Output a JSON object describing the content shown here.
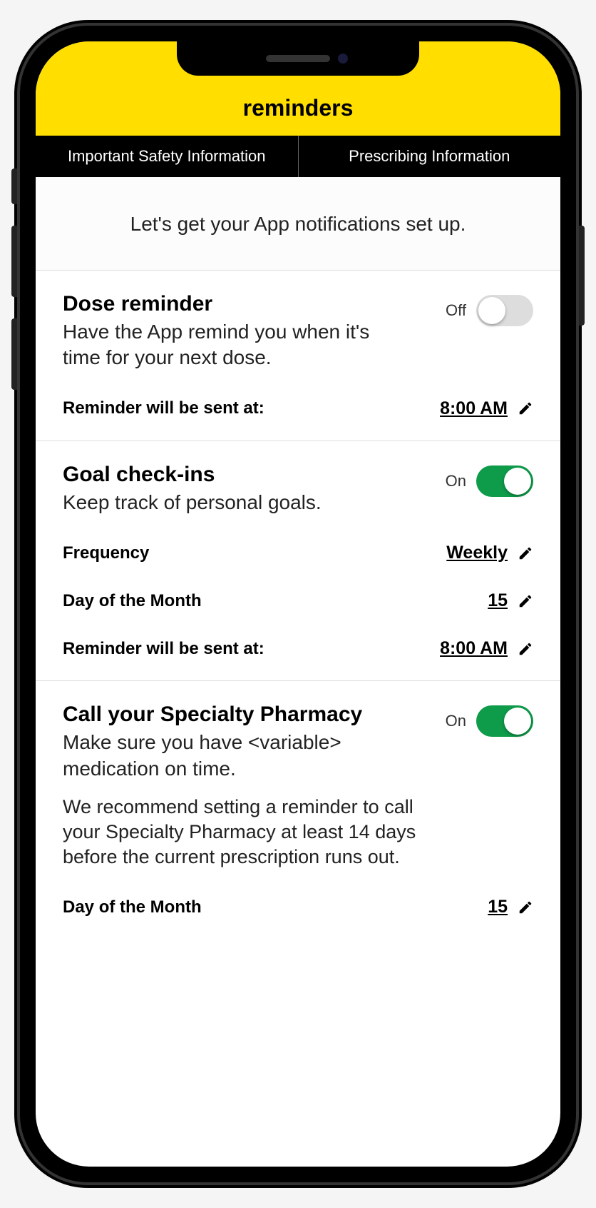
{
  "header": {
    "title": "reminders"
  },
  "tabs": {
    "safety": "Important Safety Information",
    "prescribing": "Prescribing Information"
  },
  "intro": "Let's get your App notifications set up.",
  "dose": {
    "title": "Dose reminder",
    "desc": "Have the App remind you when it's time for your next dose.",
    "state_label": "Off",
    "time_label": "Reminder will be sent at:",
    "time_value": "8:00 AM"
  },
  "goal": {
    "title": "Goal check-ins",
    "desc": "Keep track of personal goals.",
    "state_label": "On",
    "freq_label": "Frequency",
    "freq_value": "Weekly",
    "dom_label": "Day of the Month",
    "dom_value": "15",
    "time_label": "Reminder will be sent at:",
    "time_value": "8:00 AM"
  },
  "pharmacy": {
    "title": "Call your Specialty Pharmacy",
    "desc": "Make sure you have <variable> medication on time.",
    "recommend": "We recommend setting a reminder to call your Specialty Pharmacy at least 14 days before the current prescription runs out.",
    "state_label": "On",
    "dom_label": "Day of the Month",
    "dom_value": "15"
  }
}
